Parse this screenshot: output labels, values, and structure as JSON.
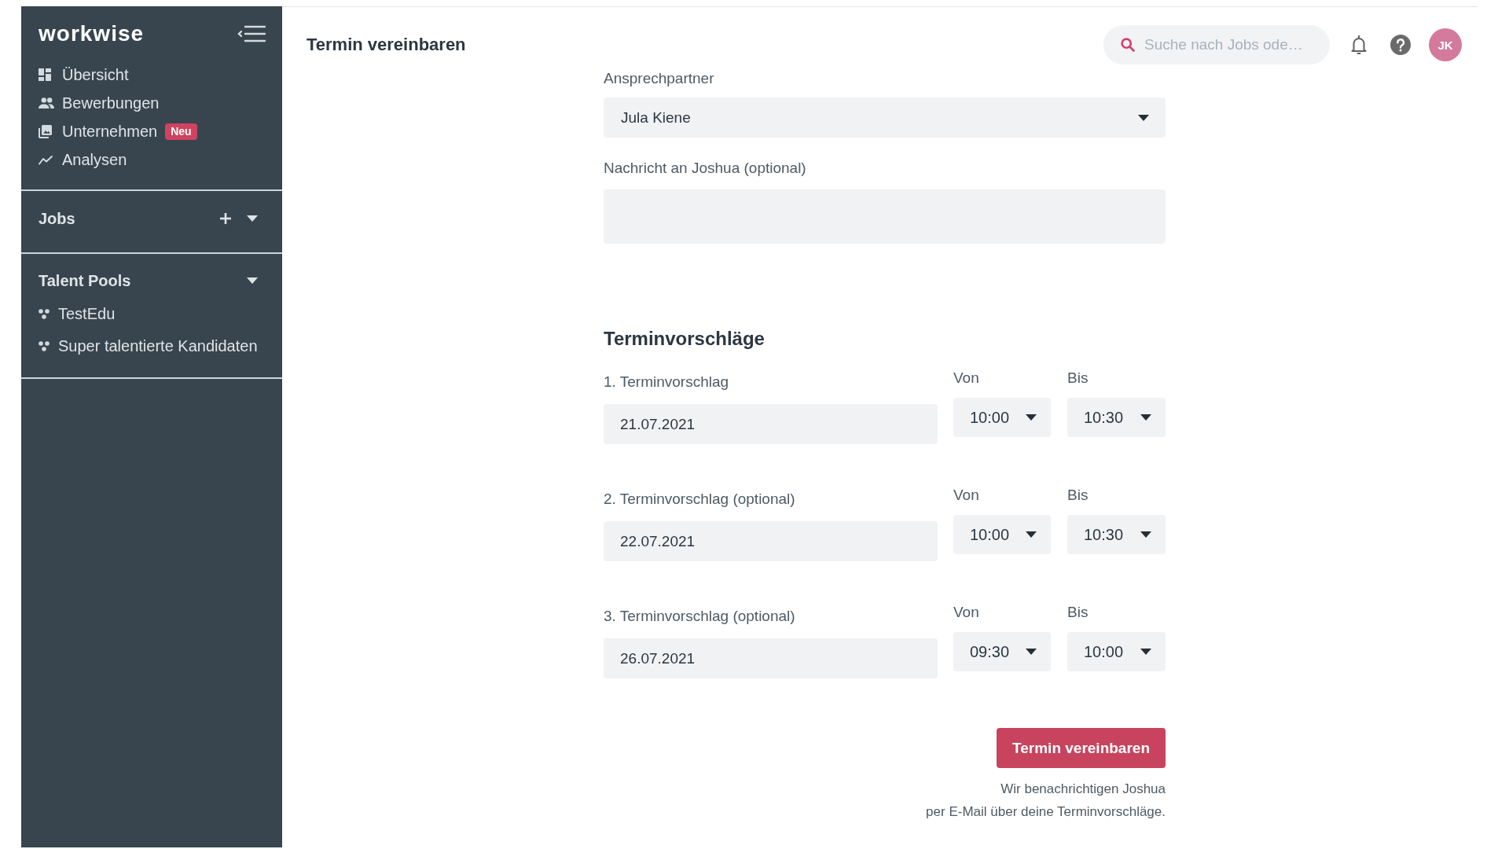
{
  "sidebar": {
    "logo": "workwise",
    "nav": [
      {
        "label": "Übersicht"
      },
      {
        "label": "Bewerbungen"
      },
      {
        "label": "Unternehmen",
        "badge": "Neu"
      },
      {
        "label": "Analysen"
      }
    ],
    "jobs": {
      "title": "Jobs"
    },
    "talent_pools": {
      "title": "Talent Pools",
      "items": [
        "TestEdu",
        "Super talentierte Kandidaten"
      ]
    }
  },
  "header": {
    "title": "Termin vereinbaren",
    "search": {
      "placeholder": "Suche nach Jobs ode…"
    },
    "avatar": "JK"
  },
  "form": {
    "contact": {
      "label": "Ansprechpartner",
      "value": "Jula Kiene"
    },
    "message": {
      "label": "Nachricht an Joshua (optional)"
    },
    "proposals": {
      "heading": "Terminvorschläge",
      "rows": [
        {
          "label": "1. Terminvorschlag",
          "date": "21.07.2021",
          "from": {
            "label": "Von",
            "value": "10:00"
          },
          "to": {
            "label": "Bis",
            "value": "10:30"
          }
        },
        {
          "label": "2. Terminvorschlag (optional)",
          "date": "22.07.2021",
          "from": {
            "label": "Von",
            "value": "10:00"
          },
          "to": {
            "label": "Bis",
            "value": "10:30"
          }
        },
        {
          "label": "3. Terminvorschlag (optional)",
          "date": "26.07.2021",
          "from": {
            "label": "Von",
            "value": "09:30"
          },
          "to": {
            "label": "Bis",
            "value": "10:00"
          }
        }
      ]
    },
    "submit": "Termin vereinbaren",
    "note": [
      "Wir benachrichtigen Joshua",
      "per E-Mail über deine Terminvorschläge."
    ]
  }
}
